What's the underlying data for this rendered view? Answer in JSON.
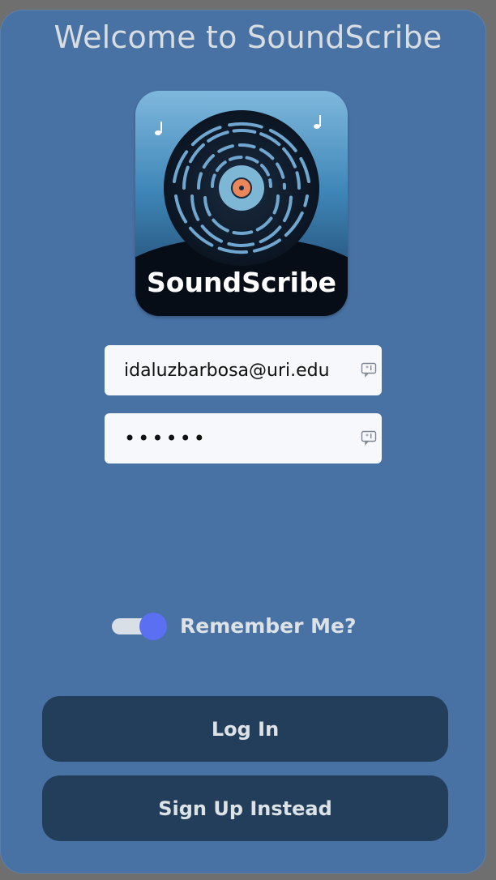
{
  "header": {
    "title": "Welcome to SoundScribe"
  },
  "logo": {
    "text": "SoundScribe"
  },
  "form": {
    "email_value": "idaluzbarbosa@uri.edu",
    "password_value": "••••••",
    "remember_label": "Remember Me?",
    "remember_checked": true
  },
  "actions": {
    "login_label": "Log In",
    "signup_label": "Sign Up Instead"
  },
  "colors": {
    "background": "#4871a4",
    "button": "#233e5a",
    "toggle_knob": "#5b6ff2"
  }
}
